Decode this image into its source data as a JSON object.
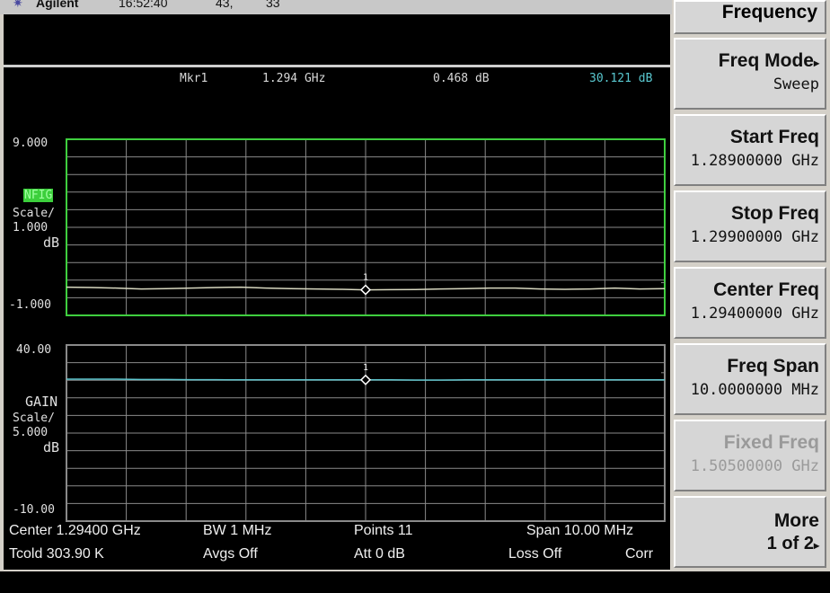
{
  "status_bar": {
    "logo_glyph": "✷",
    "brand": "Agilent",
    "time": "16:52:40",
    "field2": "43,",
    "field3": "33"
  },
  "marker": {
    "label": "Mkr1",
    "frequency": "1.294 GHz",
    "nfig_value": "0.468 dB",
    "gain_value": "30.121 dB"
  },
  "nfig_graph": {
    "top_label": "9.000",
    "trace_label": "NFIG",
    "scale_label": "Scale/",
    "scale_value": "1.000",
    "unit": "dB",
    "bottom_label": "-1.000",
    "border_color": "#3fcf3f",
    "marker_number": "1",
    "y_range": [
      -1.0,
      9.0
    ],
    "trace_values": [
      0.6,
      0.58,
      0.55,
      0.5,
      0.52,
      0.55,
      0.58,
      0.6,
      0.55,
      0.52,
      0.5,
      0.48,
      0.45,
      0.46,
      0.468,
      0.5,
      0.52,
      0.55,
      0.55,
      0.5,
      0.48,
      0.5,
      0.55,
      0.5,
      0.52
    ]
  },
  "gain_graph": {
    "top_label": "40.00",
    "trace_label": "GAIN",
    "scale_label": "Scale/",
    "scale_value": "5.000",
    "unit": "dB",
    "bottom_label": "-10.00",
    "marker_number": "1",
    "y_range": [
      -10.0,
      40.0
    ],
    "trace_values": [
      30.3,
      30.3,
      30.3,
      30.2,
      30.2,
      30.15,
      30.15,
      30.1,
      30.1,
      30.12,
      30.121,
      30.12,
      30.1,
      30.1,
      30.05,
      30.05,
      30.1,
      30.1,
      30.1,
      30.1,
      30.1,
      30.1,
      30.1,
      30.1,
      30.1
    ],
    "trace_color": "#5fc8d0"
  },
  "footer": {
    "center": "Center 1.29400 GHz",
    "bw": "BW 1 MHz",
    "points": "Points 11",
    "span": "Span 10.00 MHz",
    "tcold": "Tcold 303.90 K",
    "avgs": "Avgs Off",
    "att": "Att 0 dB",
    "loss": "Loss Off",
    "corr": "Corr"
  },
  "softkeys": {
    "title": "Frequency",
    "items": [
      {
        "label": "Freq Mode",
        "value": "Sweep",
        "arrow": "▸",
        "disabled": false
      },
      {
        "label": "Start Freq",
        "value": "1.28900000 GHz",
        "disabled": false
      },
      {
        "label": "Stop Freq",
        "value": "1.29900000 GHz",
        "disabled": false
      },
      {
        "label": "Center Freq",
        "value": "1.29400000 GHz",
        "disabled": false
      },
      {
        "label": "Freq Span",
        "value": "10.0000000 MHz",
        "disabled": false
      },
      {
        "label": "Fixed Freq",
        "value": "1.50500000 GHz",
        "disabled": true
      },
      {
        "label": "More",
        "value": "1 of 2",
        "arrow": "▸",
        "disabled": false
      }
    ]
  }
}
